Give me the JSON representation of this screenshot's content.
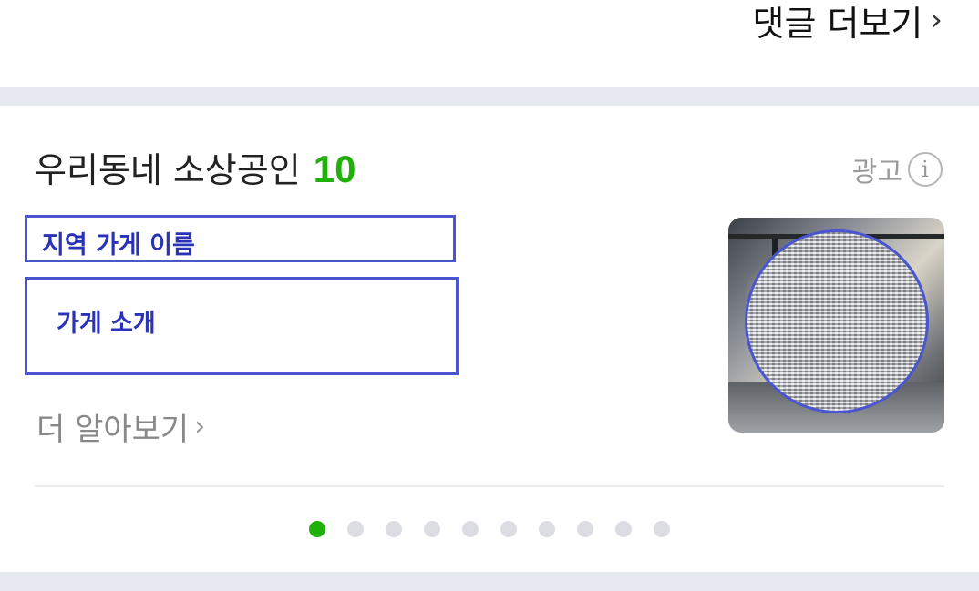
{
  "header": {
    "more_comments_label": "댓글 더보기",
    "chevron": "›"
  },
  "card": {
    "title": "우리동네 소상공인",
    "count": "10",
    "ad_label": "광고",
    "info_icon_glyph": "i",
    "store_name_placeholder": "지역 가게 이름",
    "store_intro_placeholder": "가게 소개",
    "learn_more_label": "더 알아보기",
    "chevron": "›",
    "image_icon": "store-photo",
    "pagination": {
      "total": 10,
      "current": 1
    }
  },
  "colors": {
    "accent": "#1fb00a",
    "annotation": "#4a55d0",
    "band": "#e6e8f0"
  }
}
